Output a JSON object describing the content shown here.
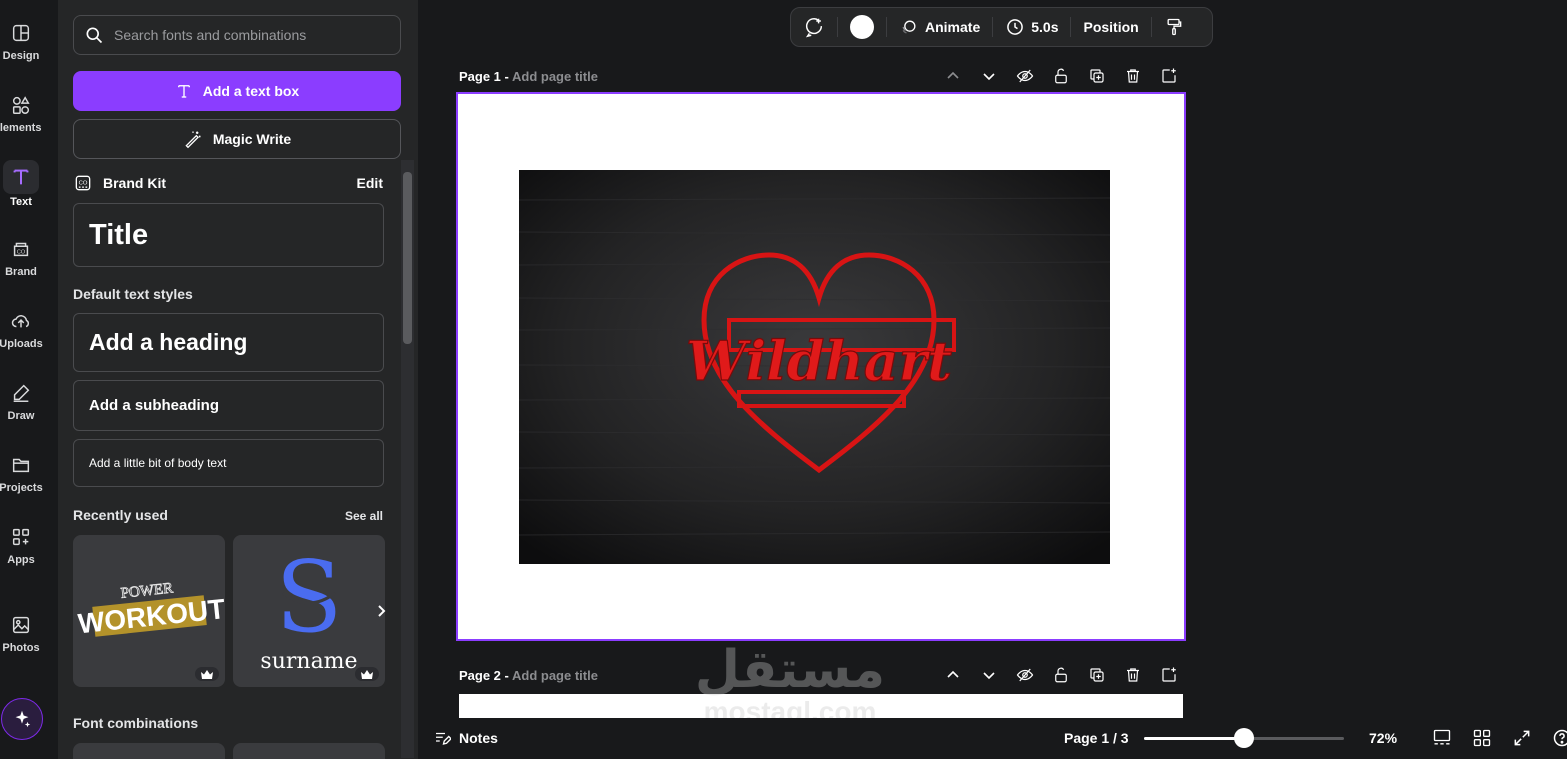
{
  "rail": {
    "items": [
      {
        "label": "Design",
        "icon": "design-icon"
      },
      {
        "label": "Elements",
        "icon": "elements-icon"
      },
      {
        "label": "Text",
        "icon": "text-icon"
      },
      {
        "label": "Brand",
        "icon": "brand-icon"
      },
      {
        "label": "Uploads",
        "icon": "uploads-icon"
      },
      {
        "label": "Draw",
        "icon": "draw-icon"
      },
      {
        "label": "Projects",
        "icon": "projects-icon"
      },
      {
        "label": "Apps",
        "icon": "apps-icon"
      },
      {
        "label": "Photos",
        "icon": "photos-icon"
      }
    ],
    "active": "Text"
  },
  "panel": {
    "search_placeholder": "Search fonts and combinations",
    "add_text_box": "Add a text box",
    "magic_write": "Magic Write",
    "brand_kit": "Brand Kit",
    "brand_edit": "Edit",
    "brand_title": "Title",
    "default_styles": "Default text styles",
    "heading": "Add a heading",
    "subheading": "Add a subheading",
    "body": "Add a little bit of body text",
    "recently_used": "Recently used",
    "see_all": "See all",
    "thumb1_line1": "POWER",
    "thumb1_line2": "WORKOUT",
    "thumb2_letter": "S",
    "thumb2_word": "surname",
    "font_combinations": "Font combinations"
  },
  "toolbar": {
    "animate": "Animate",
    "duration": "5.0s",
    "position": "Position"
  },
  "pages": [
    {
      "label": "Page 1 -",
      "title_placeholder": "Add page title"
    },
    {
      "label": "Page 2 -",
      "title_placeholder": "Add page title"
    }
  ],
  "canvas": {
    "logo_text": "Wildhart"
  },
  "footer": {
    "notes": "Notes",
    "page_indicator": "Page 1 / 3",
    "zoom": "72%",
    "zoom_level": 0.5
  },
  "watermark": {
    "arabic": "مستقل",
    "latin": "mostaql.com"
  },
  "colors": {
    "accent": "#8b3dff",
    "panel_bg": "#252627",
    "app_bg": "#18191b",
    "logo_red": "#e01a1a"
  }
}
